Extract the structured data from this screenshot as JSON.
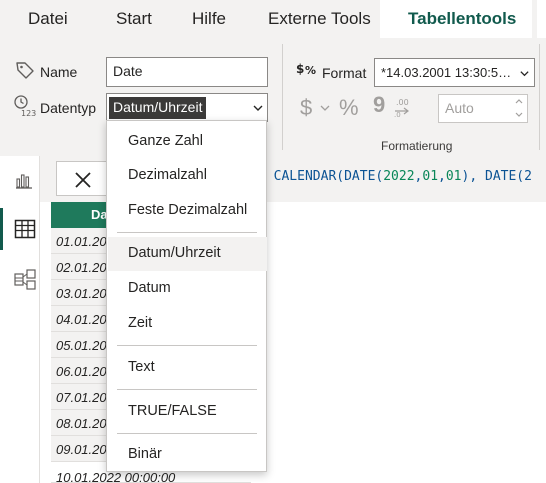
{
  "tabs": {
    "file": "Datei",
    "start": "Start",
    "help": "Hilfe",
    "external_tools": "Externe Tools",
    "table_tools": "Tabellentools"
  },
  "structure": {
    "name_label": "Name",
    "name_value": "Date",
    "datatype_label": "Datentyp",
    "datatype_value": "Datum/Uhrzeit"
  },
  "formatting": {
    "format_label": "Format",
    "format_value": "*14.03.2001 13:30:5…",
    "currency_symbol": "$",
    "percent_symbol": "%",
    "comma_symbol": "9",
    "decimal_value": "Auto",
    "group_label": "Formatierung"
  },
  "formula": {
    "prefix": "= CALENDAR(DATE(",
    "n1": "2022",
    "c1": ",",
    "n2": "01",
    "c2": ",",
    "n3": "01",
    "mid": "), DATE(2"
  },
  "table": {
    "header": "Da",
    "rows": [
      "01.01.20",
      "02.01.20",
      "03.01.20",
      "04.01.20",
      "05.01.20",
      "06.01.20",
      "07.01.20",
      "08.01.20",
      "09.01.20"
    ],
    "last_row": "10.01.2022 00:00:00"
  },
  "dropdown": {
    "items": {
      "whole": "Ganze Zahl",
      "decimal": "Dezimalzahl",
      "fixed": "Feste Dezimalzahl",
      "datetime": "Datum/Uhrzeit",
      "date": "Datum",
      "time": "Zeit",
      "text": "Text",
      "bool": "TRUE/FALSE",
      "binary": "Binär"
    }
  },
  "colors": {
    "accent": "#115a4d",
    "header_green": "#1f7a5c",
    "ribbon_bg": "#f3f2f1"
  },
  "icons": [
    "tag-icon",
    "datatype-clock-icon",
    "format-icon",
    "report-view-icon",
    "table-view-icon",
    "model-view-icon",
    "close-icon",
    "chevron-down-icon"
  ]
}
